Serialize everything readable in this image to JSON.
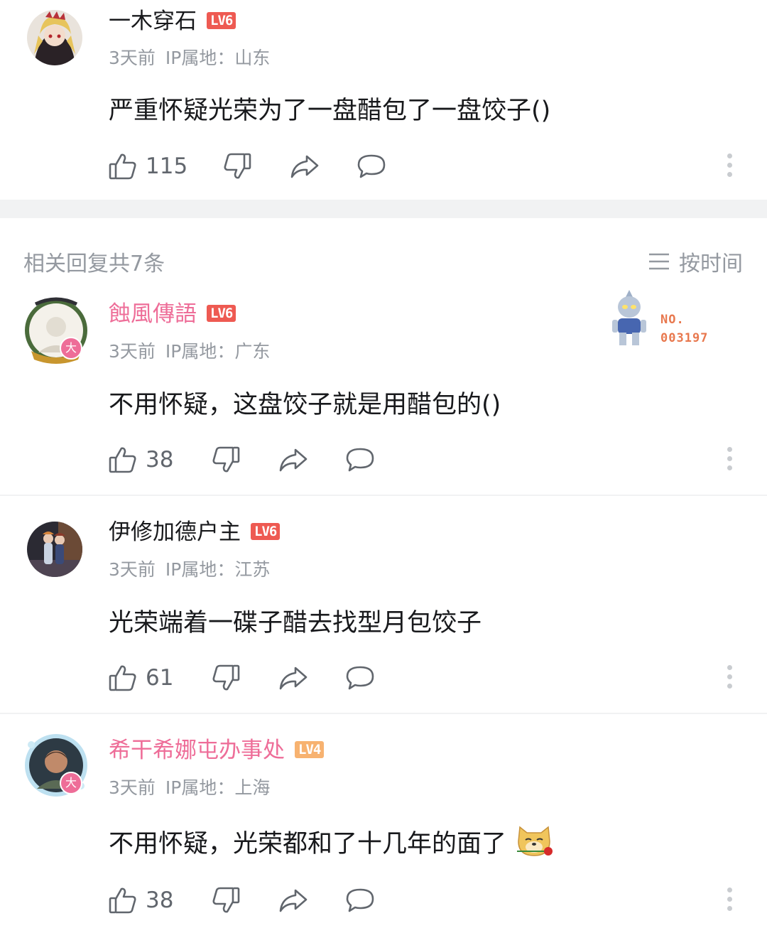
{
  "main_comment": {
    "username": "一木穿石",
    "level": "LV6",
    "time": "3天前",
    "ip": "IP属地：山东",
    "content": "严重怀疑光荣为了一盘醋包了一盘饺子()",
    "likes": "115"
  },
  "replies_header": {
    "count_label": "相关回复共7条",
    "sort_label": "按时间"
  },
  "replies": [
    {
      "username": "蝕風傳語",
      "level": "LV6",
      "badge": "大",
      "fan_number_label": "NO.",
      "fan_number": "003197",
      "time": "3天前",
      "ip": "IP属地：广东",
      "content": "不用怀疑，这盘饺子就是用醋包的()",
      "likes": "38"
    },
    {
      "username": "伊修加德户主",
      "level": "LV6",
      "time": "3天前",
      "ip": "IP属地：江苏",
      "content": "光荣端着一碟子醋去找型月包饺子",
      "likes": "61"
    },
    {
      "username": "希干希娜屯办事处",
      "level": "LV4",
      "badge": "大",
      "time": "3天前",
      "ip": "IP属地：上海",
      "content": "不用怀疑，光荣都和了十几年的面了",
      "likes": "38"
    }
  ],
  "colors": {
    "vip_name": "#ee6d98",
    "lv6": "#ee5a52",
    "lv4": "#f7b270",
    "meta_text": "#9499a0",
    "divider": "#f1f2f3"
  },
  "icons": [
    "like-icon",
    "dislike-icon",
    "share-icon",
    "reply-icon",
    "more-icon",
    "sort-icon",
    "emoji-doge-rose-icon"
  ]
}
